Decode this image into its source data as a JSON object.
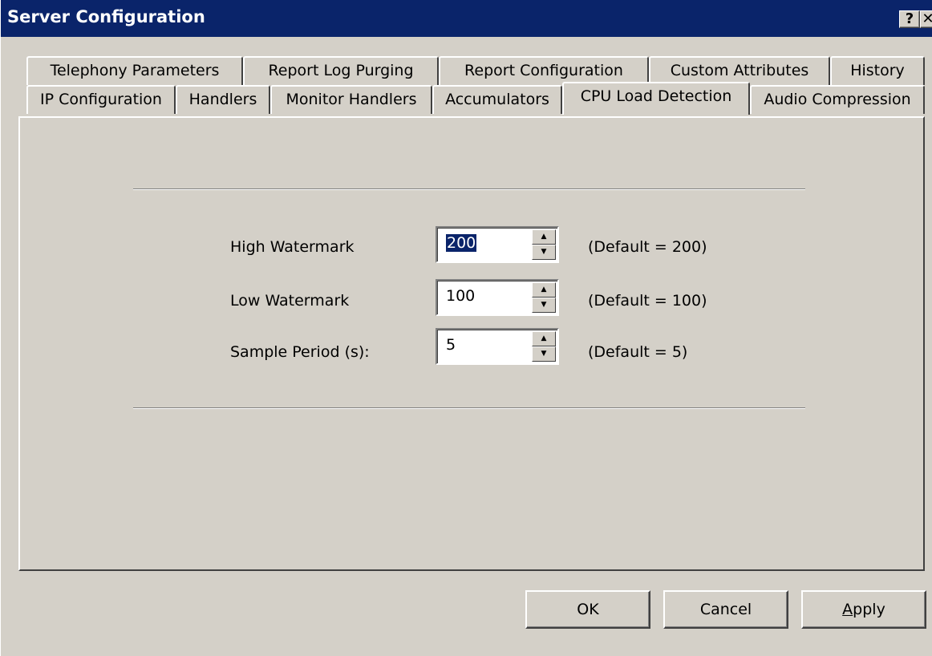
{
  "window": {
    "title": "Server Configuration",
    "help_label": "?",
    "close_label": "✕"
  },
  "tabs": {
    "row1": [
      "Telephony Parameters",
      "Report Log Purging",
      "Report Configuration",
      "Custom Attributes",
      "History"
    ],
    "row2": [
      "IP Configuration",
      "Handlers",
      "Monitor Handlers",
      "Accumulators",
      "CPU Load Detection",
      "Audio Compression"
    ],
    "active": "CPU Load Detection"
  },
  "fields": {
    "high": {
      "label": "High Watermark",
      "value": "200",
      "default": "(Default = 200)"
    },
    "low": {
      "label": "Low Watermark",
      "value": "100",
      "default": "(Default = 100)"
    },
    "sample": {
      "label": "Sample Period (s):",
      "value": "5",
      "default": "(Default = 5)"
    }
  },
  "buttons": {
    "ok": "OK",
    "cancel": "Cancel",
    "apply_accel": "A",
    "apply_rest": "pply"
  },
  "icons": {
    "spin_up": "▲",
    "spin_down": "▼"
  },
  "colors": {
    "title_bar": "#0a246a",
    "face": "#d4d0c8",
    "selection": "#0a246a"
  }
}
